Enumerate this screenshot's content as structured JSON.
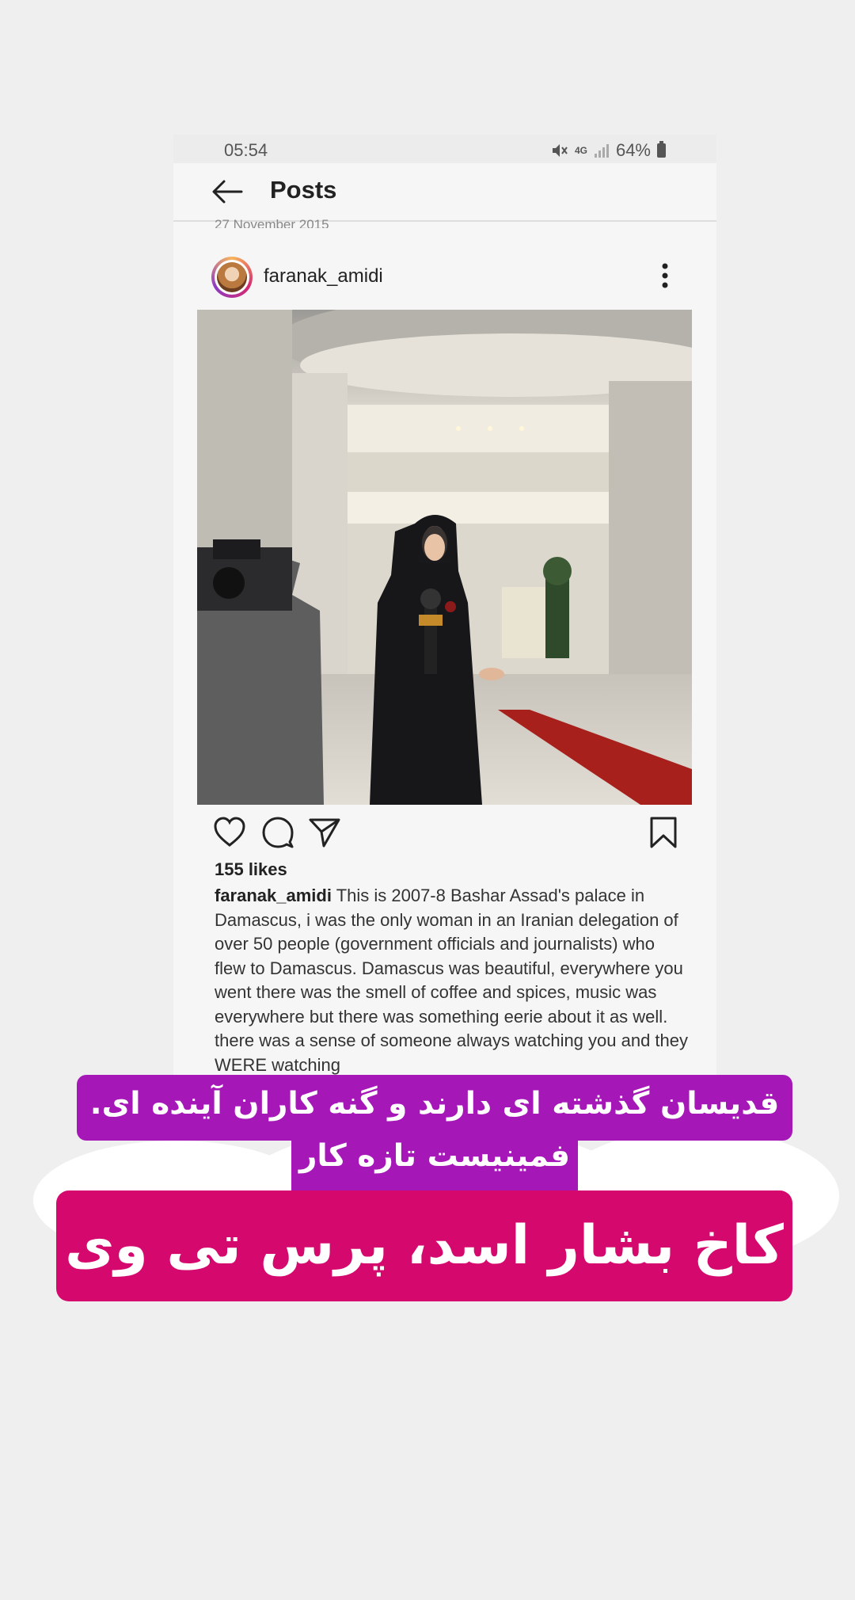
{
  "status_bar": {
    "time": "05:54",
    "network": "4G",
    "battery": "64%"
  },
  "header": {
    "title": "Posts"
  },
  "date_peek": "27 November 2015",
  "post": {
    "username": "faranak_amidi",
    "likes": "155 likes",
    "caption_user": "faranak_amidi",
    "caption_text": "This is 2007-8 Bashar Assad's palace in Damascus, i was the only woman in an Iranian delegation of over 50 people (government officials and journalists) who flew to Damascus. Damascus was beautiful, everywhere you went there was the smell of coffee and spices, music was everywhere but there was something eerie about it as well. there was a sense of someone always watching you and they WERE watching"
  },
  "overlay": {
    "purple_line1": "قدیسان گذشته ای دارند و گنه کاران آینده ای.",
    "purple_line2": "فمینیست تازه کار",
    "magenta_text": "کاخ بشار اسد، پرس تی وی"
  },
  "colors": {
    "purple": "#a617b8",
    "magenta": "#d5086e",
    "page_bg": "#efefef"
  },
  "icons": [
    "back-arrow-icon",
    "more-vertical-icon",
    "heart-icon",
    "comment-icon",
    "share-icon",
    "bookmark-icon",
    "mute-icon",
    "signal-icon",
    "battery-icon"
  ]
}
